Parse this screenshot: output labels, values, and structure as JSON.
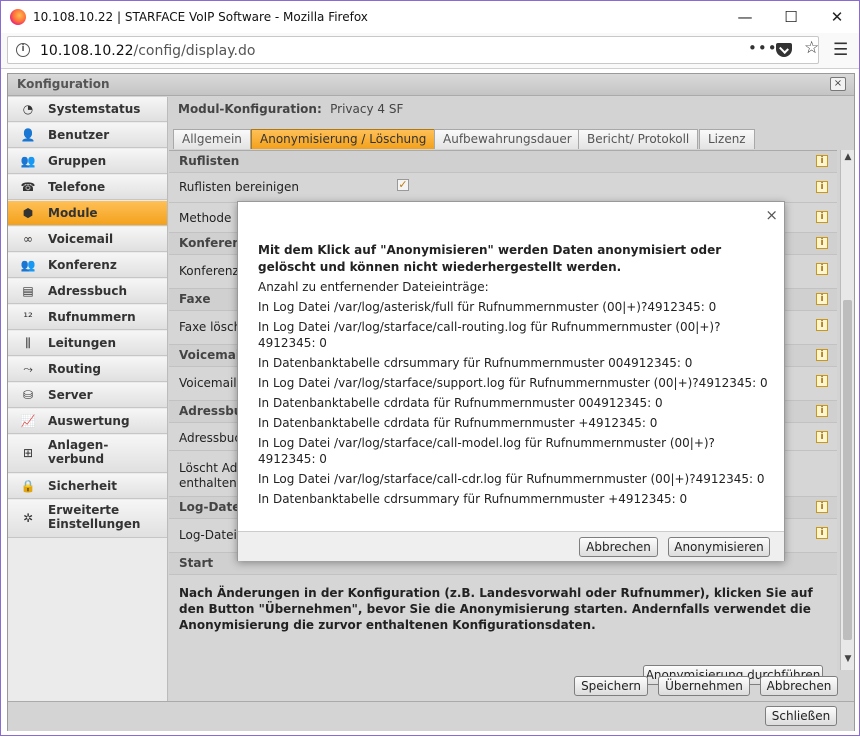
{
  "browser": {
    "window_title": "10.108.10.22 | STARFACE VoIP Software - Mozilla Firefox",
    "url_host": "10.108.10.22",
    "url_path": "/config/display.do",
    "url_actions_glyph": "•••",
    "star_glyph": "☆",
    "menu_glyph": "☰",
    "minimize_glyph": "—",
    "maximize_glyph": "☐",
    "close_glyph": "✕",
    "info_glyph": "i"
  },
  "app": {
    "title": "Konfiguration",
    "close_glyph": "×"
  },
  "sidebar": {
    "items": [
      {
        "label": "Systemstatus",
        "icon": "pie-chart-icon",
        "glyph": "◔"
      },
      {
        "label": "Benutzer",
        "icon": "user-icon",
        "glyph": "👤"
      },
      {
        "label": "Gruppen",
        "icon": "group-icon",
        "glyph": "👥"
      },
      {
        "label": "Telefone",
        "icon": "phone-icon",
        "glyph": "☎"
      },
      {
        "label": "Module",
        "icon": "cube-icon",
        "glyph": "⬢"
      },
      {
        "label": "Voicemail",
        "icon": "voicemail-icon",
        "glyph": "∞"
      },
      {
        "label": "Konferenz",
        "icon": "conference-icon",
        "glyph": "👥"
      },
      {
        "label": "Adressbuch",
        "icon": "address-book-icon",
        "glyph": "▤"
      },
      {
        "label": "Rufnummern",
        "icon": "numbers-icon",
        "glyph": "¹²"
      },
      {
        "label": "Leitungen",
        "icon": "line-icon",
        "glyph": "⫼"
      },
      {
        "label": "Routing",
        "icon": "routing-icon",
        "glyph": "⤳"
      },
      {
        "label": "Server",
        "icon": "server-icon",
        "glyph": "⛁"
      },
      {
        "label": "Auswertung",
        "icon": "chart-icon",
        "glyph": "📈"
      },
      {
        "label": "Anlagen-\nverbund",
        "icon": "network-icon",
        "glyph": "⊞"
      },
      {
        "label": "Sicherheit",
        "icon": "lock-icon",
        "glyph": "🔒"
      },
      {
        "label": "Erweiterte\nEinstellungen",
        "icon": "advanced-settings-icon",
        "glyph": "✲"
      }
    ],
    "active": "Module"
  },
  "module": {
    "heading_label": "Modul-Konfiguration:",
    "heading_value": "Privacy 4 SF",
    "tabs": [
      "Allgemein",
      "Anonymisierung / Löschung",
      "Aufbewahrungsdauer",
      "Bericht/ Protokoll",
      "Lizenz"
    ],
    "active_tab": "Anonymisierung / Löschung"
  },
  "panel": {
    "rows": {
      "ruflisten": "Ruflisten",
      "ruflisten_bereinigen": "Ruflisten bereinigen",
      "methode": "Methode",
      "konferenz": "Konferen",
      "konferenz_sub": "Konferenz",
      "faxe": "Faxe",
      "faxe_sub": "Faxe lösch",
      "voicemail": "Voicemai",
      "voicemail_sub": "Voicemails",
      "adressbuch": "Adressbu",
      "adressbuch_sub": "Adressbuc",
      "loescht_1": "Löscht Adr",
      "loescht_2": "enthalten.",
      "logdateien": "Log-Date",
      "logdateien_sub": "Log-Dateie",
      "start": "Start"
    },
    "checkbox_glyph": "✓",
    "info_glyph": "i",
    "warning": "Nach Änderungen in der Konfiguration (z.B. Landesvorwahl oder Rufnummer), klicken Sie auf den Button \"Übernehmen\", bevor Sie die Anonymisierung starten. Andernfalls verwendet die Anonymisierung die zurvor enthaltenen Konfigurationsdaten.",
    "run_button": "Anonymisierung durchführen",
    "scroll_up": "▲",
    "scroll_down": "▼"
  },
  "actions": {
    "save": "Speichern",
    "apply": "Übernehmen",
    "cancel": "Abbrechen",
    "close": "Schließen"
  },
  "dialog": {
    "close_glyph": "×",
    "heading": "Mit dem Klick auf \"Anonymisieren\" werden Daten anonymisiert oder gelöscht und können nicht wiederhergestellt werden.",
    "count_label": "Anzahl zu entfernender Dateieinträge:",
    "entries": [
      "In Log Datei /var/log/asterisk/full für Rufnummernmuster (00|+)?4912345: 0",
      "In Log Datei /var/log/starface/call-routing.log für Rufnummernmuster (00|+)?4912345: 0",
      "In Datenbanktabelle cdrsummary für Rufnummernmuster 004912345: 0",
      "In Log Datei /var/log/starface/support.log für Rufnummernmuster (00|+)?4912345: 0",
      "In Datenbanktabelle cdrdata für Rufnummernmuster 004912345: 0",
      "In Datenbanktabelle cdrdata für Rufnummernmuster +4912345: 0",
      "In Log Datei /var/log/starface/call-model.log für Rufnummernmuster (00|+)?4912345: 0",
      "In Log Datei /var/log/starface/call-cdr.log für Rufnummernmuster (00|+)?4912345: 0",
      "In Datenbanktabelle cdrsummary für Rufnummernmuster +4912345: 0"
    ],
    "cancel": "Abbrechen",
    "confirm": "Anonymisieren"
  }
}
